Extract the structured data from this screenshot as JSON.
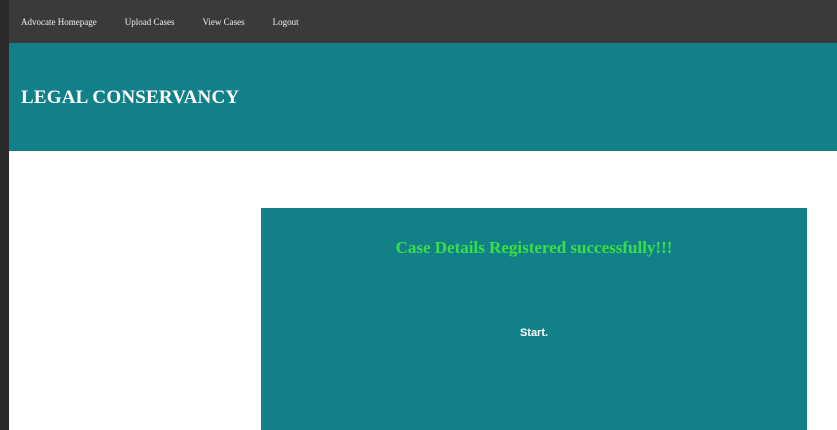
{
  "nav": {
    "items": [
      {
        "label": "Advocate Homepage"
      },
      {
        "label": "Upload Cases"
      },
      {
        "label": "View Cases"
      },
      {
        "label": "Logout"
      }
    ]
  },
  "header": {
    "title": "LEGAL CONSERVANCY"
  },
  "panel": {
    "message": "Case Details Registered successfully!!!",
    "start_label": "Start."
  },
  "colors": {
    "nav_bg": "#3a3a3a",
    "brand_teal": "#128088",
    "success_green": "#39e043"
  }
}
